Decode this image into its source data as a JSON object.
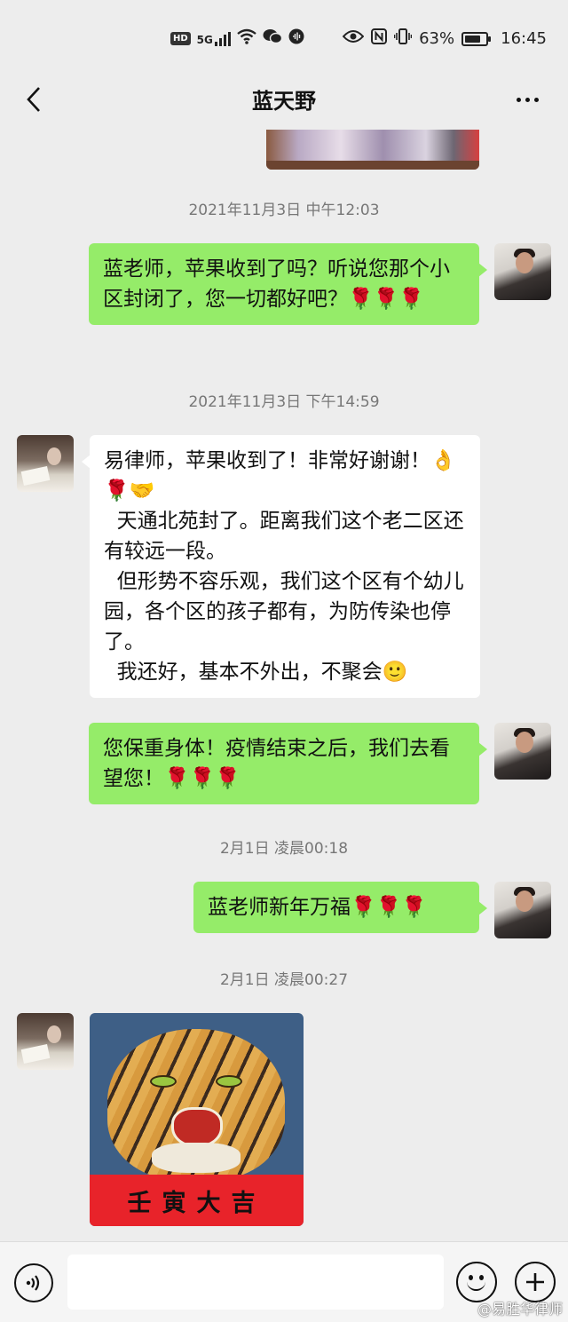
{
  "status_bar": {
    "hd": "HD",
    "signal_label": "5G",
    "battery_text": "63%",
    "battery_level": 0.63,
    "time": "16:45"
  },
  "header": {
    "back_icon": "chevron-left-icon",
    "title": "蓝天野",
    "more_icon": "more-dots-icon"
  },
  "messages": [
    {
      "type": "timestamp",
      "text": "2021年11月3日 中午12:03"
    },
    {
      "type": "text",
      "sender": "self",
      "text": "蓝老师，苹果收到了吗？听说您那个小区封闭了，您一切都好吧？🌹🌹🌹"
    },
    {
      "type": "timestamp",
      "text": "2021年11月3日 下午14:59"
    },
    {
      "type": "text",
      "sender": "other",
      "text": "易律师，苹果收到了！非常好谢谢！👌🌹🤝\n  天通北苑封了。距离我们这个老二区还有较远一段。\n  但形势不容乐观，我们这个区有个幼儿园，各个区的孩子都有，为防传染也停了。\n  我还好，基本不外出，不聚会🙂"
    },
    {
      "type": "text",
      "sender": "self",
      "text": "您保重身体！疫情结束之后，我们去看望您！🌹🌹🌹"
    },
    {
      "type": "timestamp",
      "text": "2月1日 凌晨00:18"
    },
    {
      "type": "text",
      "sender": "self",
      "text": "蓝老师新年万福🌹🌹🌹"
    },
    {
      "type": "timestamp",
      "text": "2月1日 凌晨00:27"
    },
    {
      "type": "image",
      "sender": "other",
      "banner_text": "壬寅大吉"
    }
  ],
  "input_bar": {
    "voice_icon": "voice-icon",
    "placeholder": "",
    "emoji_icon": "emoji-icon",
    "plus_icon": "plus-icon"
  },
  "watermark": "@易胜华律师",
  "colors": {
    "self_bubble": "#95ec69",
    "other_bubble": "#ffffff",
    "background": "#ededed"
  }
}
